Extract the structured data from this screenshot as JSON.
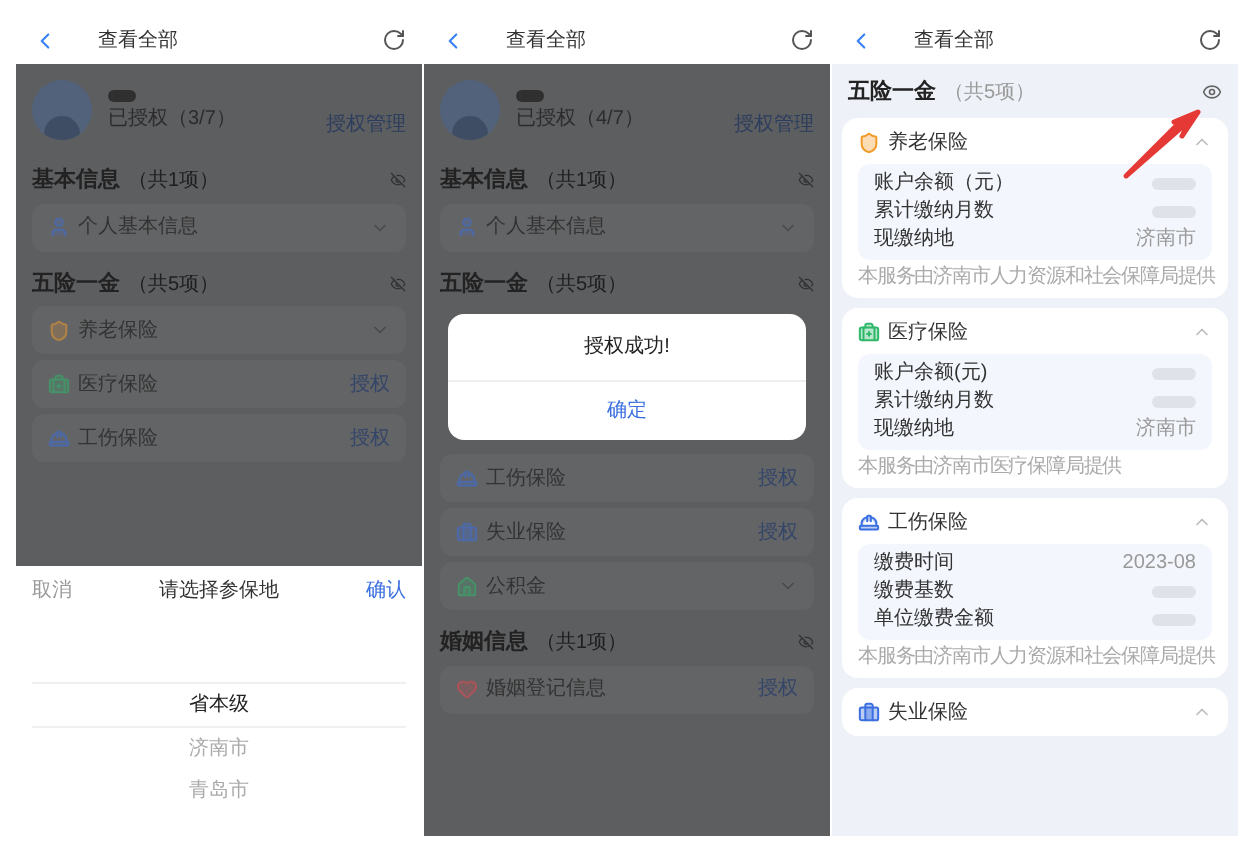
{
  "panels": [
    {
      "kind": "picker",
      "header": {
        "title": "查看全部"
      },
      "profile": {
        "status": "已授权（3/7）",
        "link": "授权管理"
      },
      "sections": [
        {
          "title": "基本信息",
          "count": "（共1项）",
          "items": [
            {
              "kind": "person",
              "label": "个人基本信息",
              "expanded": false
            }
          ]
        },
        {
          "title": "五险一金",
          "count": "（共5项）",
          "items": [
            {
              "kind": "pension",
              "label": "养老保险",
              "expanded": false
            },
            {
              "kind": "medical",
              "label": "医疗保险",
              "action": "授权"
            },
            {
              "kind": "injury",
              "label": "工伤保险",
              "action": "授权"
            }
          ]
        }
      ],
      "sheet": {
        "cancel": "取消",
        "title": "请选择参保地",
        "confirm": "确认",
        "options": [
          {
            "label": "省本级",
            "selected": true
          },
          {
            "label": "济南市",
            "selected": false
          },
          {
            "label": "青岛市",
            "selected": false
          }
        ]
      }
    },
    {
      "kind": "dialog",
      "header": {
        "title": "查看全部"
      },
      "profile": {
        "status": "已授权（4/7）",
        "link": "授权管理"
      },
      "sections": [
        {
          "title": "基本信息",
          "count": "（共1项）",
          "items": [
            {
              "kind": "person",
              "label": "个人基本信息",
              "expanded": false
            }
          ]
        },
        {
          "title": "五险一金",
          "count": "（共5项）",
          "dialog": {
            "message": "授权成功!",
            "button": "确定"
          },
          "items": [
            {
              "kind": "injury",
              "label": "工伤保险",
              "action": "授权"
            },
            {
              "kind": "unemployment",
              "label": "失业保险",
              "action": "授权"
            },
            {
              "kind": "fund",
              "label": "公积金",
              "expanded": false
            }
          ]
        },
        {
          "title": "婚姻信息",
          "count": "（共1项）",
          "items": [
            {
              "kind": "marriage",
              "label": "婚姻登记信息",
              "action": "授权"
            }
          ]
        }
      ]
    },
    {
      "kind": "detail",
      "header": {
        "title": "查看全部"
      },
      "title": "五险一金",
      "count": "（共5项）",
      "cards": [
        {
          "kind": "pension",
          "title": "养老保险",
          "expanded": true,
          "rows": [
            {
              "label": "账户余额（元）",
              "kind": "masked"
            },
            {
              "label": "累计缴纳月数",
              "kind": "masked"
            },
            {
              "label": "现缴纳地",
              "kind": "text",
              "value": "济南市"
            }
          ],
          "note": "本服务由济南市人力资源和社会保障局提供"
        },
        {
          "kind": "medical",
          "title": "医疗保险",
          "expanded": true,
          "rows": [
            {
              "label": "账户余额(元)",
              "kind": "masked"
            },
            {
              "label": "累计缴纳月数",
              "kind": "masked"
            },
            {
              "label": "现缴纳地",
              "kind": "text",
              "value": "济南市"
            }
          ],
          "note": "本服务由济南市医疗保障局提供"
        },
        {
          "kind": "injury",
          "title": "工伤保险",
          "expanded": true,
          "rows": [
            {
              "label": "缴费时间",
              "kind": "text",
              "value": "2023-08"
            },
            {
              "label": "缴费基数",
              "kind": "masked"
            },
            {
              "label": "单位缴费金额",
              "kind": "masked"
            }
          ],
          "note": "本服务由济南市人力资源和社会保障局提供"
        },
        {
          "kind": "unemployment",
          "title": "失业保险",
          "expanded": true
        }
      ]
    }
  ]
}
